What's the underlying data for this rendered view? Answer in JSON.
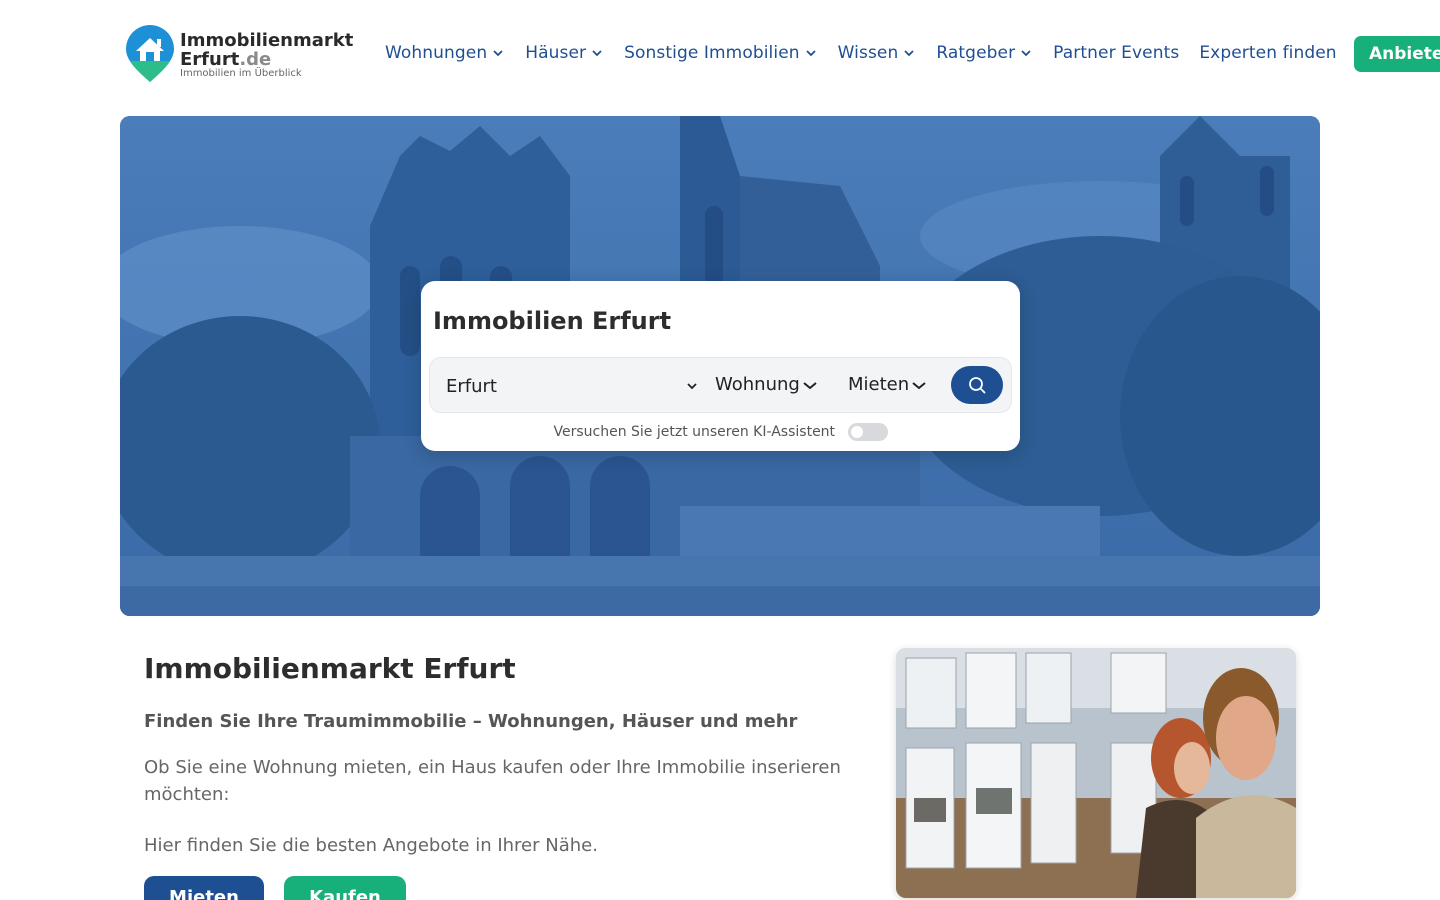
{
  "header": {
    "logo": {
      "line1": "Immobilienmarkt",
      "line2_main": "Erfurt",
      "line2_tld": ".de",
      "tagline": "Immobilien im Überblick"
    },
    "nav": [
      {
        "label": "Wohnungen",
        "dropdown": true
      },
      {
        "label": "Häuser",
        "dropdown": true
      },
      {
        "label": "Sonstige Immobilien",
        "dropdown": true
      },
      {
        "label": "Wissen",
        "dropdown": true
      },
      {
        "label": "Ratgeber",
        "dropdown": true
      },
      {
        "label": "Partner Events",
        "dropdown": false
      },
      {
        "label": "Experten finden",
        "dropdown": false
      }
    ],
    "cta_label": "Anbieten"
  },
  "search": {
    "title": "Immobilien Erfurt",
    "location_value": "Erfurt",
    "type_value": "Wohnung",
    "mode_value": "Mieten",
    "ai_label": "Versuchen Sie jetzt unseren KI-Assistent",
    "ai_enabled": false
  },
  "content": {
    "title": "Immobilienmarkt Erfurt",
    "subtitle": "Finden Sie Ihre Traumimmobilie – Wohnungen, Häuser und mehr",
    "paragraph1": "Ob Sie eine Wohnung mieten, ein Haus kaufen oder Ihre Immobilie inserieren möchten:",
    "paragraph2": "Hier finden Sie die besten Angebote in Ihrer Nähe.",
    "btn_rent": "Mieten",
    "btn_buy": "Kaufen"
  },
  "colors": {
    "primary": "#1f4f93",
    "accent": "#17b07a",
    "hero_tint": "#3c6ea8"
  },
  "icons": {
    "logo": "house-pin-icon",
    "nav_chevron": "chevron-down-icon",
    "search": "search-icon"
  }
}
